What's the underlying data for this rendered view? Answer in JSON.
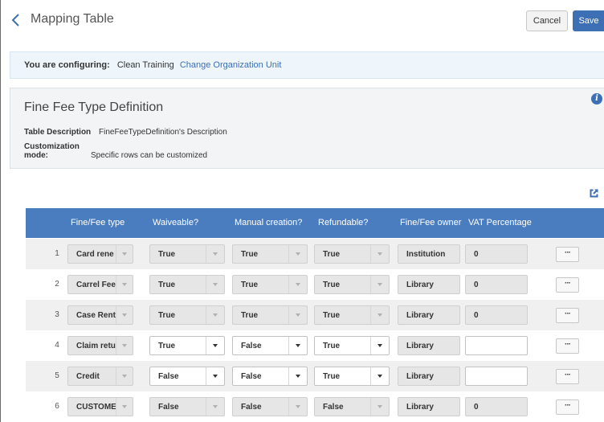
{
  "header": {
    "title": "Mapping Table",
    "cancel_label": "Cancel",
    "save_label": "Save"
  },
  "config": {
    "label": "You are configuring:",
    "value": "Clean Training",
    "link": "Change Organization Unit"
  },
  "definition": {
    "title": "Fine Fee Type Definition",
    "desc_key": "Table Description",
    "desc_value": "FineFeeTypeDefinition's Description",
    "mode_key": "Customization mode:",
    "mode_value": "Specific rows can be customized"
  },
  "table": {
    "columns": [
      "Fine/Fee type",
      "Waiveable?",
      "Manual creation?",
      "Refundable?",
      "Fine/Fee owner",
      "VAT Percentage"
    ],
    "more_label": "···",
    "rows": [
      {
        "num": "1",
        "type": "Card rene",
        "waiveable": "True",
        "manual": "True",
        "refundable": "True",
        "owner": "Institution",
        "vat": "0"
      },
      {
        "num": "2",
        "type": "Carrel Fee",
        "waiveable": "True",
        "manual": "True",
        "refundable": "True",
        "owner": "Library",
        "vat": "0"
      },
      {
        "num": "3",
        "type": "Case Rent",
        "waiveable": "True",
        "manual": "True",
        "refundable": "True",
        "owner": "Library",
        "vat": "0"
      },
      {
        "num": "4",
        "type": "Claim retu",
        "waiveable": "True",
        "manual": "False",
        "refundable": "True",
        "owner": "Library",
        "vat": ""
      },
      {
        "num": "5",
        "type": "Credit",
        "waiveable": "False",
        "manual": "False",
        "refundable": "True",
        "owner": "Library",
        "vat": ""
      },
      {
        "num": "6",
        "type": "CUSTOME",
        "waiveable": "False",
        "manual": "False",
        "refundable": "False",
        "owner": "Library",
        "vat": "0"
      }
    ]
  },
  "colors": {
    "accent": "#3d6fb4",
    "table_header": "#4a7dc0",
    "banner_bg": "#eef6fb",
    "panel_bg": "#f2f4f5"
  },
  "icons": {
    "back": "chevron-left-icon",
    "info": "info-icon",
    "export": "external-link-icon",
    "dropdown": "caret-down-icon"
  }
}
